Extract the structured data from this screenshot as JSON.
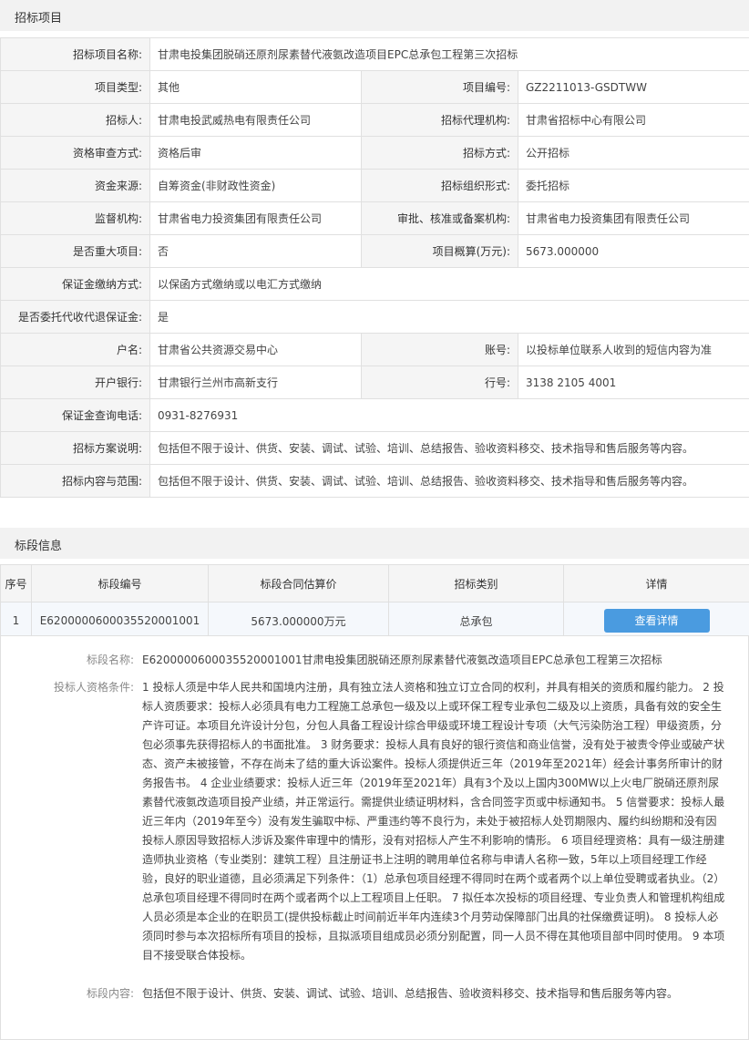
{
  "project_section": {
    "title": "招标项目",
    "rows": [
      {
        "label": "招标项目名称:",
        "value": "甘肃电投集团脱硝还原剂尿素替代液氨改造项目EPC总承包工程第三次招标"
      },
      {
        "label": "项目类型:",
        "value": "其他",
        "label2": "项目编号:",
        "value2": "GZ2211013-GSDTWW"
      },
      {
        "label": "招标人:",
        "value": "甘肃电投武威热电有限责任公司",
        "label2": "招标代理机构:",
        "value2": "甘肃省招标中心有限公司"
      },
      {
        "label": "资格审查方式:",
        "value": "资格后审",
        "label2": "招标方式:",
        "value2": "公开招标"
      },
      {
        "label": "资金来源:",
        "value": "自筹资金(非财政性资金)",
        "label2": "招标组织形式:",
        "value2": "委托招标"
      },
      {
        "label": "监督机构:",
        "value": "甘肃省电力投资集团有限责任公司",
        "label2": "审批、核准或备案机构:",
        "value2": "甘肃省电力投资集团有限责任公司"
      },
      {
        "label": "是否重大项目:",
        "value": "否",
        "label2": "项目概算(万元):",
        "value2": "5673.000000"
      },
      {
        "label": "保证金缴纳方式:",
        "value": "以保函方式缴纳或以电汇方式缴纳"
      },
      {
        "label": "是否委托代收代退保证金:",
        "value": "是"
      },
      {
        "label": "户名:",
        "value": "甘肃省公共资源交易中心",
        "label2": "账号:",
        "value2": "以投标单位联系人收到的短信内容为准"
      },
      {
        "label": "开户银行:",
        "value": "甘肃银行兰州市高新支行",
        "label2": "行号:",
        "value2": "3138 2105 4001"
      },
      {
        "label": "保证金查询电话:",
        "value": "0931-8276931"
      },
      {
        "label": "招标方案说明:",
        "value": "包括但不限于设计、供货、安装、调试、试验、培训、总结报告、验收资料移交、技术指导和售后服务等内容。"
      },
      {
        "label": "招标内容与范围:",
        "value": "包括但不限于设计、供货、安装、调试、试验、培训、总结报告、验收资料移交、技术指导和售后服务等内容。"
      }
    ]
  },
  "segment_section": {
    "title": "标段信息",
    "columns": [
      "序号",
      "标段编号",
      "标段合同估算价",
      "招标类别",
      "详情"
    ],
    "row": {
      "index": "1",
      "code": "E6200000600035520001001",
      "price": "5673.000000万元",
      "category": "总承包",
      "button": "查看详情"
    },
    "detail": {
      "name_label": "标段名称:",
      "name_value": "E6200000600035520001001甘肃电投集团脱硝还原剂尿素替代液氨改造项目EPC总承包工程第三次招标",
      "qual_label": "投标人资格条件:",
      "qual_value": "1 投标人须是中华人民共和国境内注册，具有独立法人资格和独立订立合同的权利，并具有相关的资质和履约能力。 2 投标人资质要求：投标人必须具有电力工程施工总承包一级及以上或环保工程专业承包二级及以上资质，具备有效的安全生产许可证。本项目允许设计分包，分包人具备工程设计综合甲级或环境工程设计专项（大气污染防治工程）甲级资质，分包必须事先获得招标人的书面批准。 3 财务要求：投标人具有良好的银行资信和商业信誉，没有处于被责令停业或破产状态、资产未被接管，不存在尚未了结的重大诉讼案件。投标人须提供近三年（2019年至2021年）经会计事务所审计的财务报告书。 4 企业业绩要求：投标人近三年（2019年至2021年）具有3个及以上国内300MW以上火电厂脱硝还原剂尿素替代液氨改造项目投产业绩，并正常运行。需提供业绩证明材料，含合同签字页或中标通知书。 5 信誉要求：投标人最近三年内（2019年至今）没有发生骗取中标、严重违约等不良行为，未处于被招标人处罚期限内、履约纠纷期和没有因投标人原因导致招标人涉诉及案件审理中的情形，没有对招标人产生不利影响的情形。 6 项目经理资格：具有一级注册建造师执业资格（专业类别：建筑工程）且注册证书上注明的聘用单位名称与申请人名称一致，5年以上项目经理工作经验，良好的职业道德，且必须满足下列条件：（1）总承包项目经理不得同时在两个或者两个以上单位受聘或者执业。（2）总承包项目经理不得同时在两个或者两个以上工程项目上任职。 7 拟任本次投标的项目经理、专业负责人和管理机构组成人员必须是本企业的在职员工(提供投标截止时间前近半年内连续3个月劳动保障部门出具的社保缴费证明)。 8 投标人必须同时参与本次招标所有项目的投标，且拟派项目组成员必须分别配置，同一人员不得在其他项目部中同时使用。 9 本项目不接受联合体投标。",
      "content_label": "标段内容:",
      "content_value": "包括但不限于设计、供货、安装、调试、试验、培训、总结报告、验收资料移交、技术指导和售后服务等内容。"
    }
  }
}
